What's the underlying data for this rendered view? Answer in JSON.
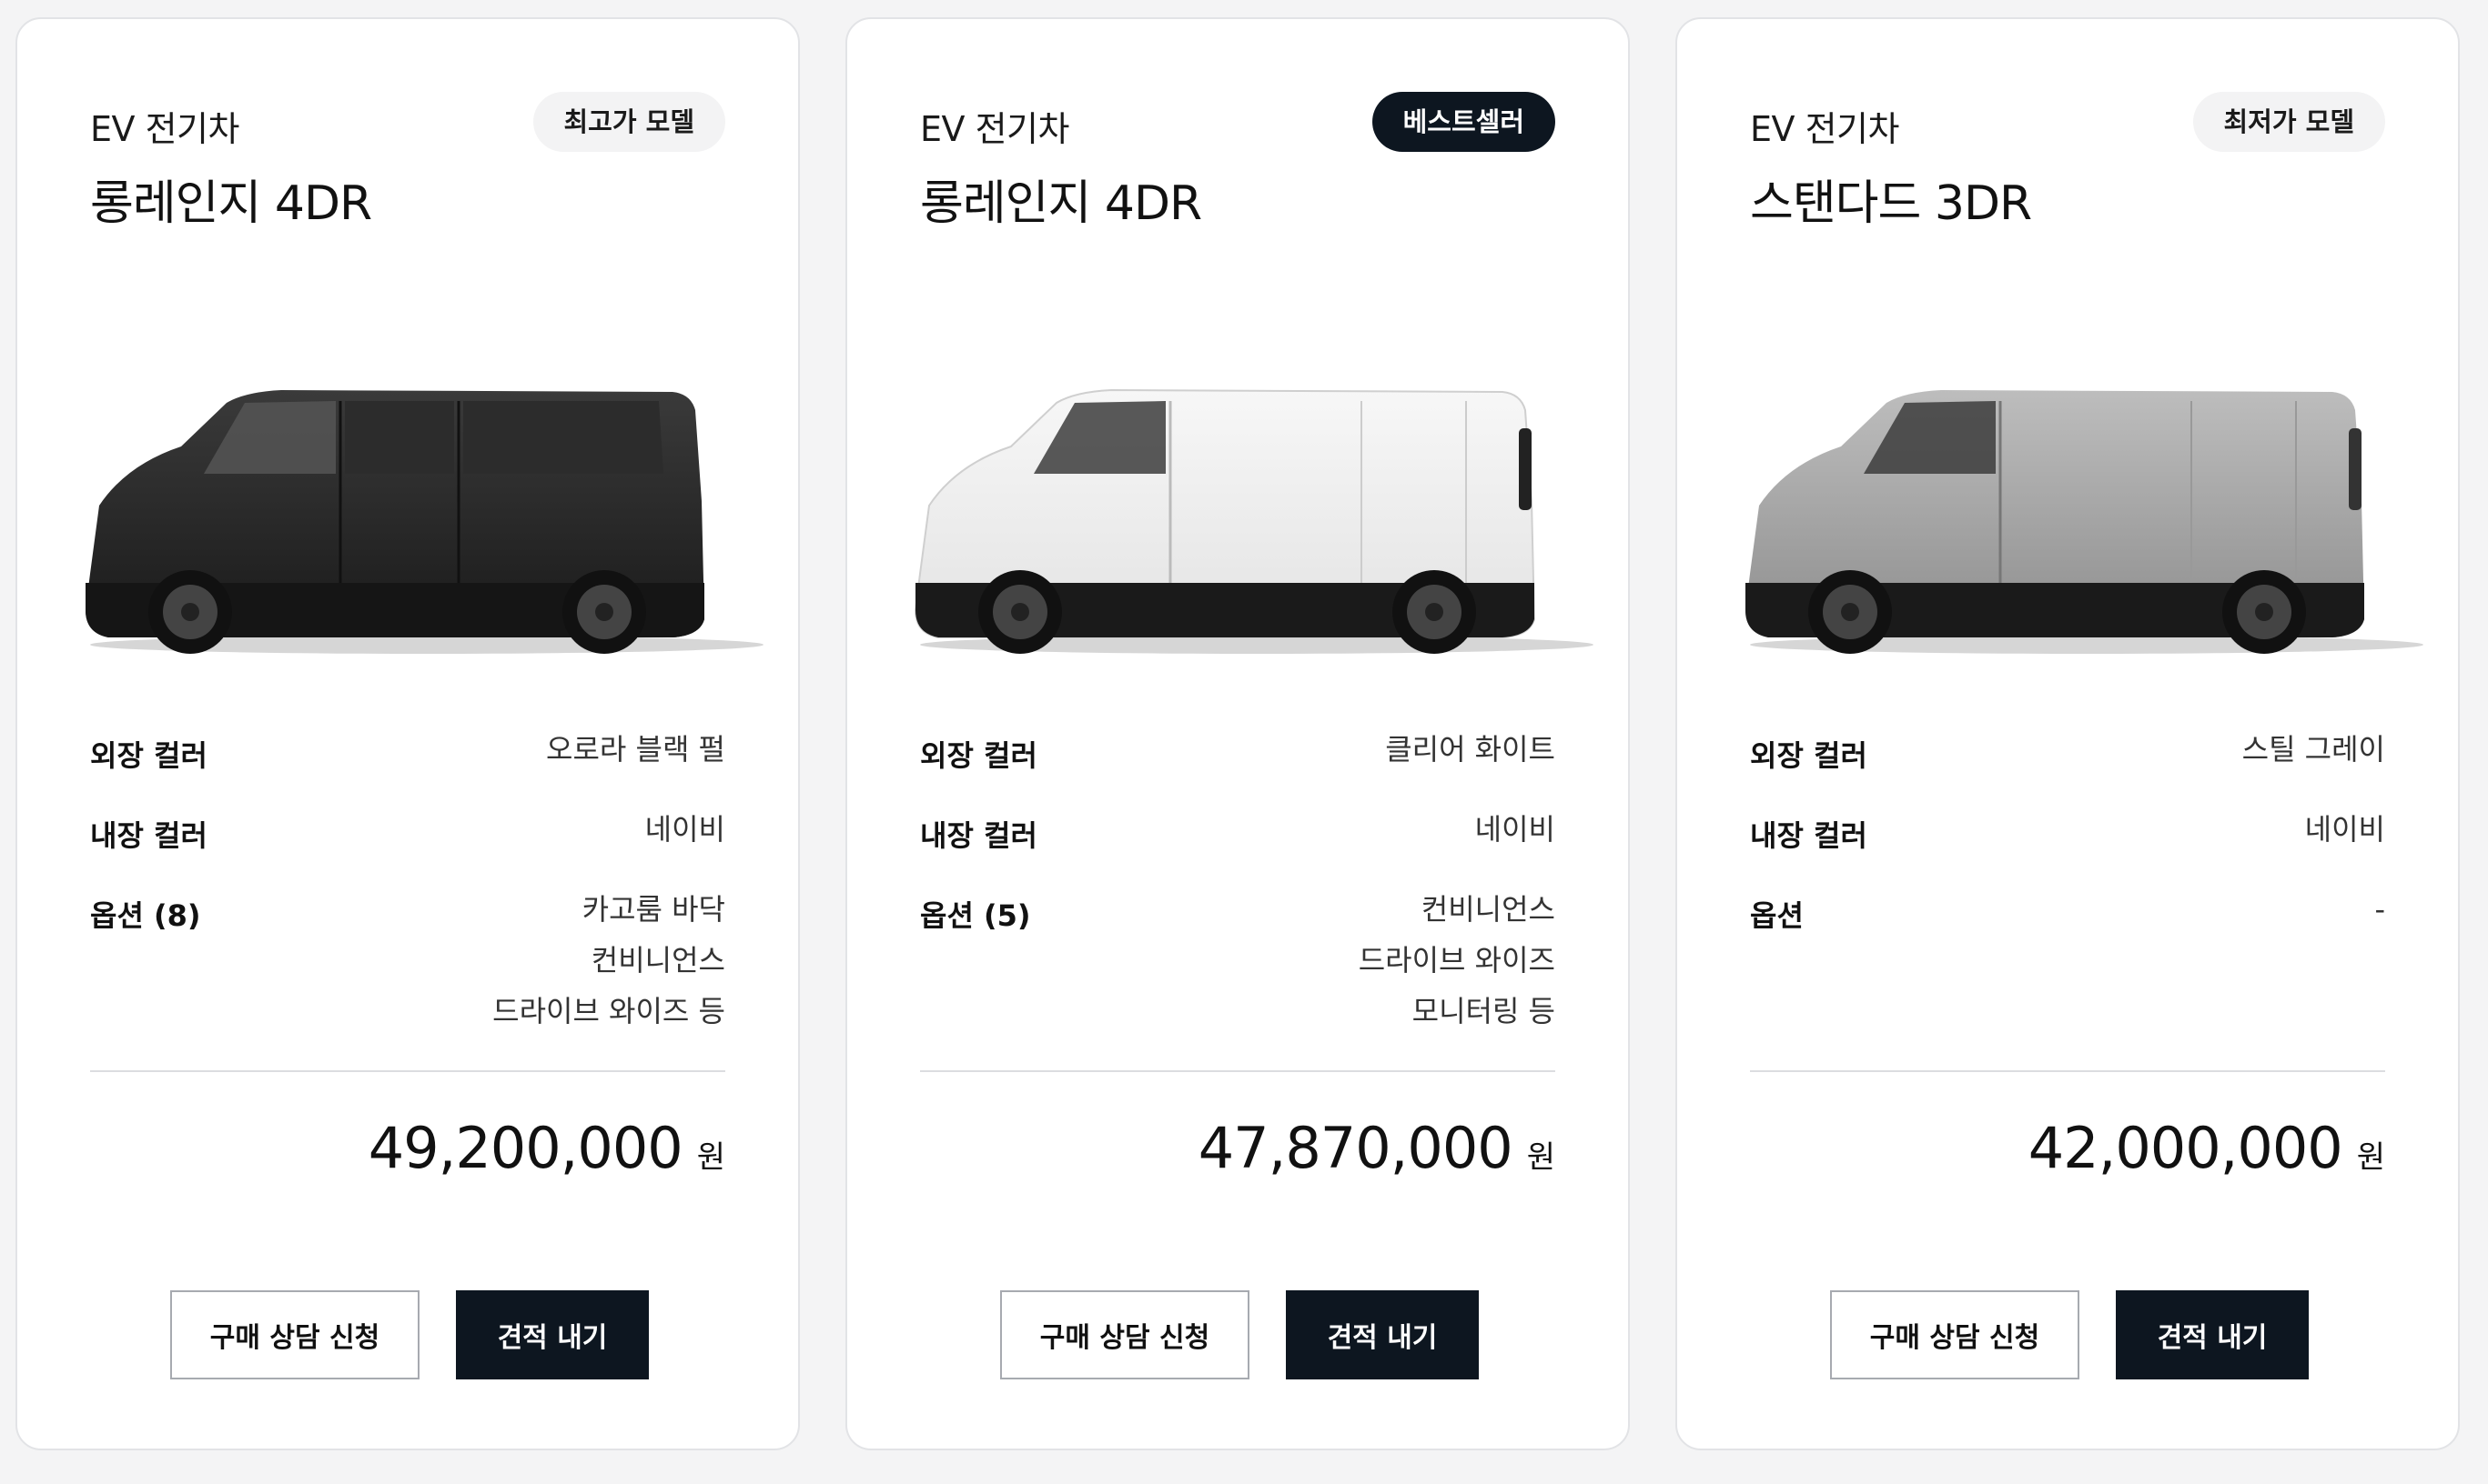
{
  "colors": {
    "dark_navy": "#0d1620",
    "badge_light": "#f3f3f4",
    "card_border": "#e2e3e6"
  },
  "cards": [
    {
      "category": "EV 전기차",
      "model": "롱레인지 4DR",
      "badge": "최고가 모델",
      "badge_style": "light",
      "van_color": "black",
      "exterior_label": "외장 컬러",
      "exterior_value": "오로라 블랙 펄",
      "interior_label": "내장 컬러",
      "interior_value": "네이비",
      "options_label": "옵션 (8)",
      "options": [
        "카고룸 바닥",
        "컨비니언스",
        "드라이브 와이즈 등"
      ],
      "price": "49,200,000",
      "currency": "원",
      "consult_button": "구매 상담 신청",
      "quote_button": "견적 내기"
    },
    {
      "category": "EV 전기차",
      "model": "롱레인지 4DR",
      "badge": "베스트셀러",
      "badge_style": "dark",
      "van_color": "white",
      "exterior_label": "외장 컬러",
      "exterior_value": "클리어 화이트",
      "interior_label": "내장 컬러",
      "interior_value": "네이비",
      "options_label": "옵션 (5)",
      "options": [
        "컨비니언스",
        "드라이브 와이즈",
        "모니터링 등"
      ],
      "price": "47,870,000",
      "currency": "원",
      "consult_button": "구매 상담 신청",
      "quote_button": "견적 내기"
    },
    {
      "category": "EV 전기차",
      "model": "스탠다드 3DR",
      "badge": "최저가 모델",
      "badge_style": "light",
      "van_color": "gray",
      "exterior_label": "외장 컬러",
      "exterior_value": "스틸 그레이",
      "interior_label": "내장 컬러",
      "interior_value": "네이비",
      "options_label": "옵션",
      "options": [
        "-"
      ],
      "price": "42,000,000",
      "currency": "원",
      "consult_button": "구매 상담 신청",
      "quote_button": "견적 내기"
    }
  ]
}
